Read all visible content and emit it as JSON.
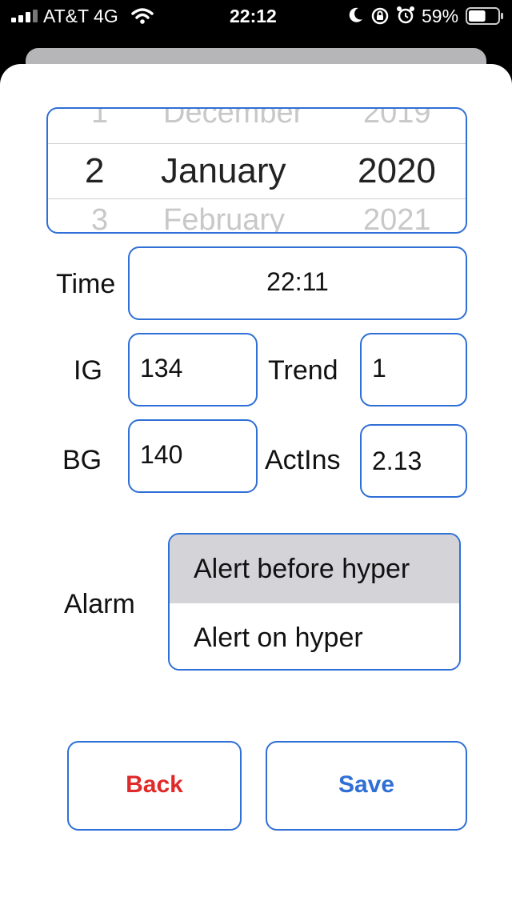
{
  "status_bar": {
    "carrier": "AT&T 4G",
    "time": "22:12",
    "battery": "59%",
    "battery_level": 0.59
  },
  "date_picker": {
    "day_prev": "1",
    "day": "2",
    "day_next": "3",
    "month_prev": "December",
    "month": "January",
    "month_next": "February",
    "year_prev": "2019",
    "year": "2020",
    "year_next": "2021"
  },
  "form": {
    "time_label": "Time",
    "time_value": "22:11",
    "ig_label": "IG",
    "ig_value": "134",
    "trend_label": "Trend",
    "trend_value": "1",
    "bg_label": "BG",
    "bg_value": "140",
    "actins_label": "ActIns",
    "actins_value": "2.13",
    "alarm_label": "Alarm",
    "alarm_options": [
      "Alert before hyper",
      "Alert on hyper"
    ]
  },
  "buttons": {
    "back": "Back",
    "save": "Save"
  },
  "colors": {
    "accent": "#2f6fd6",
    "back_text": "#e02a2a",
    "save_text": "#2f6fd6",
    "selected_bg": "#d4d4d8"
  }
}
